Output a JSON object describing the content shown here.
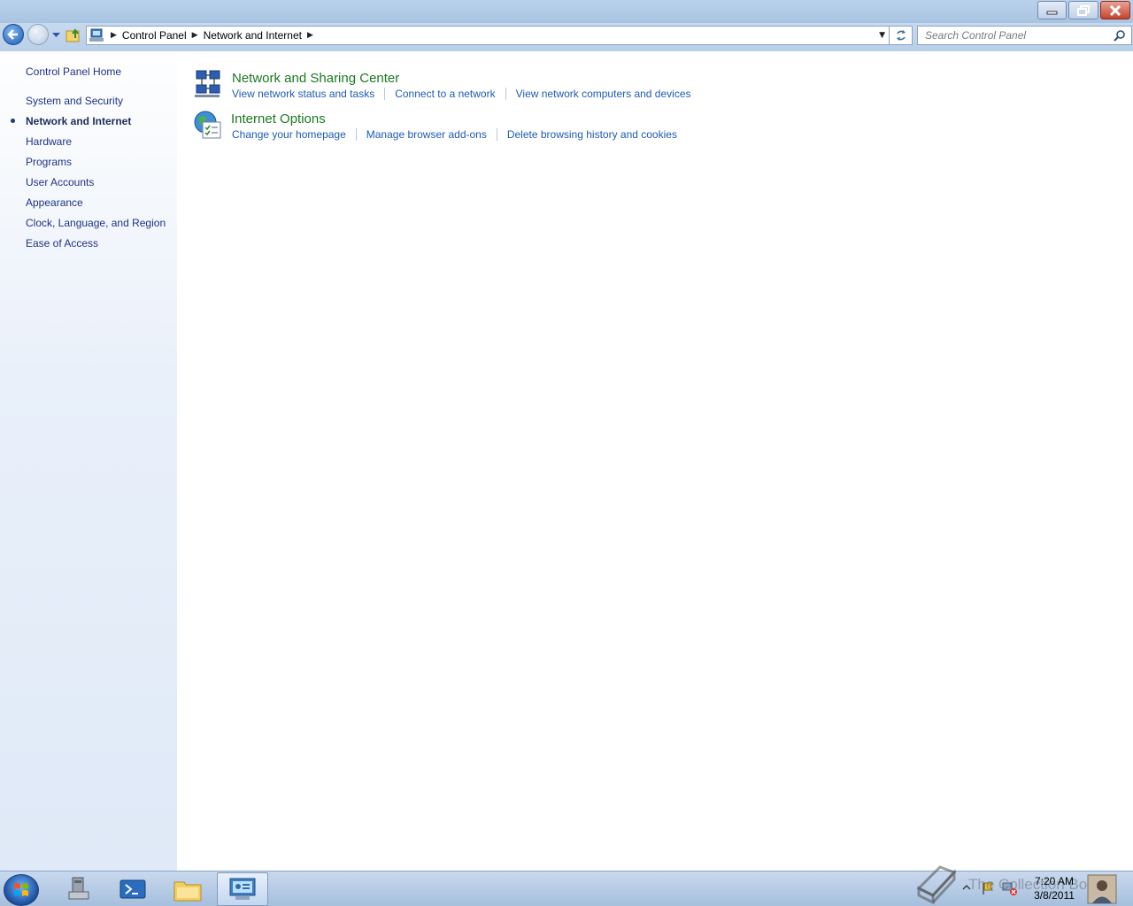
{
  "window": {
    "minimize_icon": "minimize-icon",
    "maximize_icon": "restore-icon",
    "close_icon": "close-icon"
  },
  "nav": {
    "breadcrumb": [
      "Control Panel",
      "Network and Internet"
    ],
    "search_placeholder": "Search Control Panel"
  },
  "sidebar": {
    "home": "Control Panel Home",
    "items": [
      {
        "label": "System and Security"
      },
      {
        "label": "Network and Internet",
        "active": true
      },
      {
        "label": "Hardware"
      },
      {
        "label": "Programs"
      },
      {
        "label": "User Accounts"
      },
      {
        "label": "Appearance"
      },
      {
        "label": "Clock, Language, and Region"
      },
      {
        "label": "Ease of Access"
      }
    ]
  },
  "categories": [
    {
      "title": "Network and Sharing Center",
      "icon": "network-sharing-icon",
      "links": [
        "View network status and tasks",
        "Connect to a network",
        "View network computers and devices"
      ]
    },
    {
      "title": "Internet Options",
      "icon": "internet-options-icon",
      "links": [
        "Change your homepage",
        "Manage browser add-ons",
        "Delete browsing history and cookies"
      ]
    }
  ],
  "taskbar": {
    "time": "7:20 AM",
    "date": "3/8/2011",
    "watermark": "The Collection Book"
  },
  "colors": {
    "category_title": "#1a7a20",
    "link": "#1e5bb5",
    "sidebar_link": "#1e3287"
  }
}
